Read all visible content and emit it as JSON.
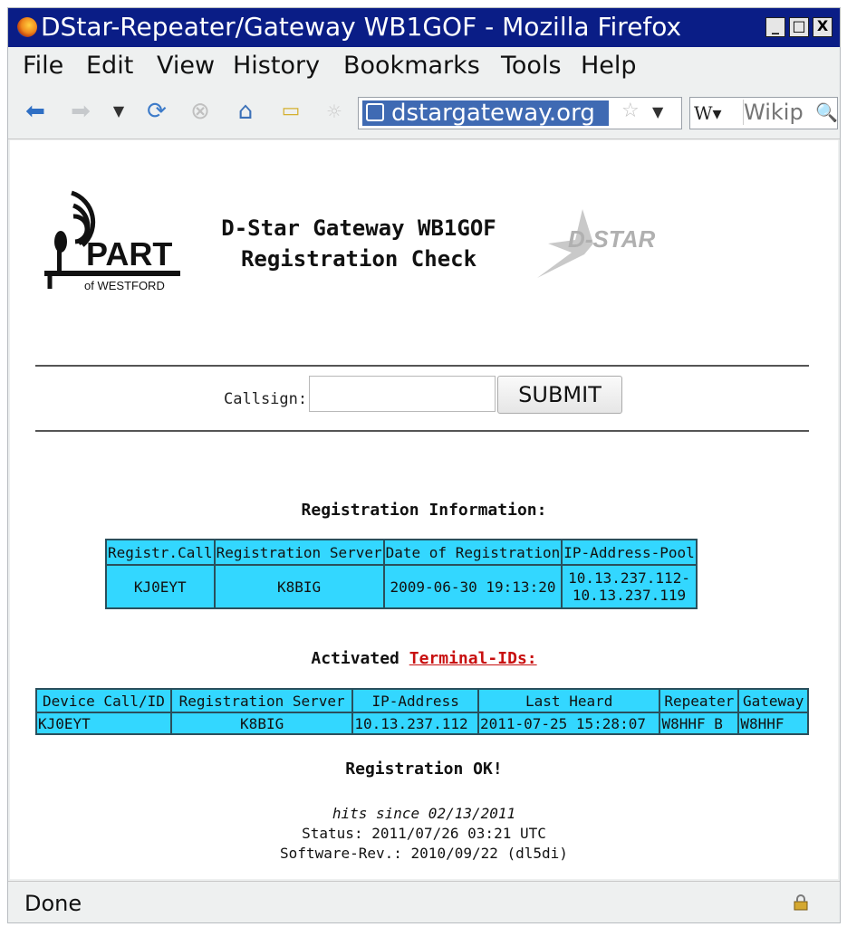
{
  "window": {
    "title": "DStar-Repeater/Gateway WB1GOF - Mozilla Firefox",
    "controls": [
      "_",
      "□",
      "X"
    ]
  },
  "menu": [
    "File",
    "Edit",
    "View",
    "History",
    "Bookmarks",
    "Tools",
    "Help"
  ],
  "toolbar": {
    "url": "dstargateway.org",
    "search_engine": "W▾",
    "search_placeholder": "Wikip"
  },
  "page": {
    "logo_left": {
      "brand": "PART",
      "sub": "of WESTFORD"
    },
    "title_line1": "D-Star Gateway WB1GOF",
    "title_line2": "Registration Check",
    "logo_right": "D-STAR",
    "form": {
      "callsign_label": "Callsign:",
      "callsign_value": "",
      "submit_label": "SUBMIT"
    },
    "registration": {
      "heading": "Registration Information:",
      "columns": [
        "Registr.Call",
        "Registration Server",
        "Date of Registration",
        "IP-Address-Pool"
      ],
      "row": {
        "call": "KJ0EYT",
        "server": "K8BIG",
        "date": "2009-06-30 19:13:20",
        "pool_line1": "10.13.237.112-",
        "pool_line2": "10.13.237.119"
      }
    },
    "terminal": {
      "heading_prefix": "Activated ",
      "heading_link": "Terminal-IDs:",
      "columns": [
        "Device Call/ID",
        "Registration Server",
        "IP-Address",
        "Last Heard",
        "Repeater",
        "Gateway"
      ],
      "row": {
        "device": "KJ0EYT",
        "server": "K8BIG",
        "ip": "10.13.237.112",
        "last_heard": "2011-07-25 15:28:07",
        "repeater": "W8HHF B",
        "gateway": "W8HHF"
      }
    },
    "result": "Registration OK!",
    "footer": {
      "hits": "hits since 02/13/2011",
      "status": "Status: 2011/07/26 03:21 UTC",
      "software": "Software-Rev.: 2010/09/22 (dl5di)"
    }
  },
  "statusbar": {
    "text": "Done"
  },
  "colors": {
    "titlebar": "#0a1d86",
    "table_cell": "#33d7ff",
    "link": "#c81010",
    "url_highlight": "#3f6ab3"
  }
}
